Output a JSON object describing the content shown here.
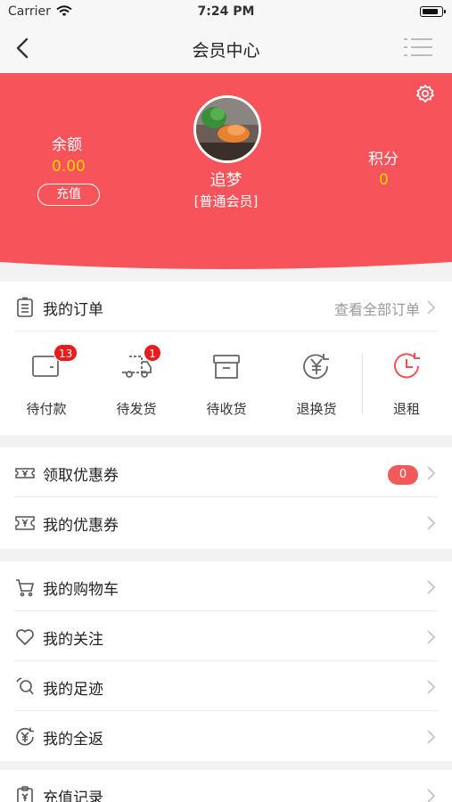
{
  "status_bar": {
    "carrier": "Carrier",
    "time": "7:24 PM"
  },
  "nav": {
    "title": "会员中心",
    "back_icon": "chevron-left-icon",
    "menu_icon": "list-icon"
  },
  "colors": {
    "brand_red": "#f6545a",
    "gold": "#ffd400",
    "badge_red": "#e81c1c"
  },
  "profile": {
    "balance_label": "余额",
    "balance_value": "0.00",
    "recharge_label": "充值",
    "nickname": "追梦",
    "level": "[普通会员]",
    "points_label": "积分",
    "points_value": "0"
  },
  "orders": {
    "title": "我的订单",
    "view_all": "查看全部订单",
    "items": [
      {
        "label": "待付款",
        "icon": "wallet-icon",
        "badge": "13"
      },
      {
        "label": "待发货",
        "icon": "truck-icon",
        "badge": "1"
      },
      {
        "label": "待收货",
        "icon": "box-icon"
      },
      {
        "label": "退换货",
        "icon": "yuan-return-icon"
      },
      {
        "label": "退租",
        "icon": "clock-return-icon"
      }
    ]
  },
  "coupons": [
    {
      "label": "领取优惠券",
      "icon": "coupon-get-icon",
      "count": "0"
    },
    {
      "label": "我的优惠券",
      "icon": "coupon-icon"
    }
  ],
  "menu": [
    {
      "label": "我的购物车",
      "icon": "cart-icon"
    },
    {
      "label": "我的关注",
      "icon": "heart-icon"
    },
    {
      "label": "我的足迹",
      "icon": "footprint-icon"
    },
    {
      "label": "我的全返",
      "icon": "yuan-cycle-icon"
    }
  ],
  "records": [
    {
      "label": "充值记录",
      "icon": "clipboard-icon"
    }
  ]
}
